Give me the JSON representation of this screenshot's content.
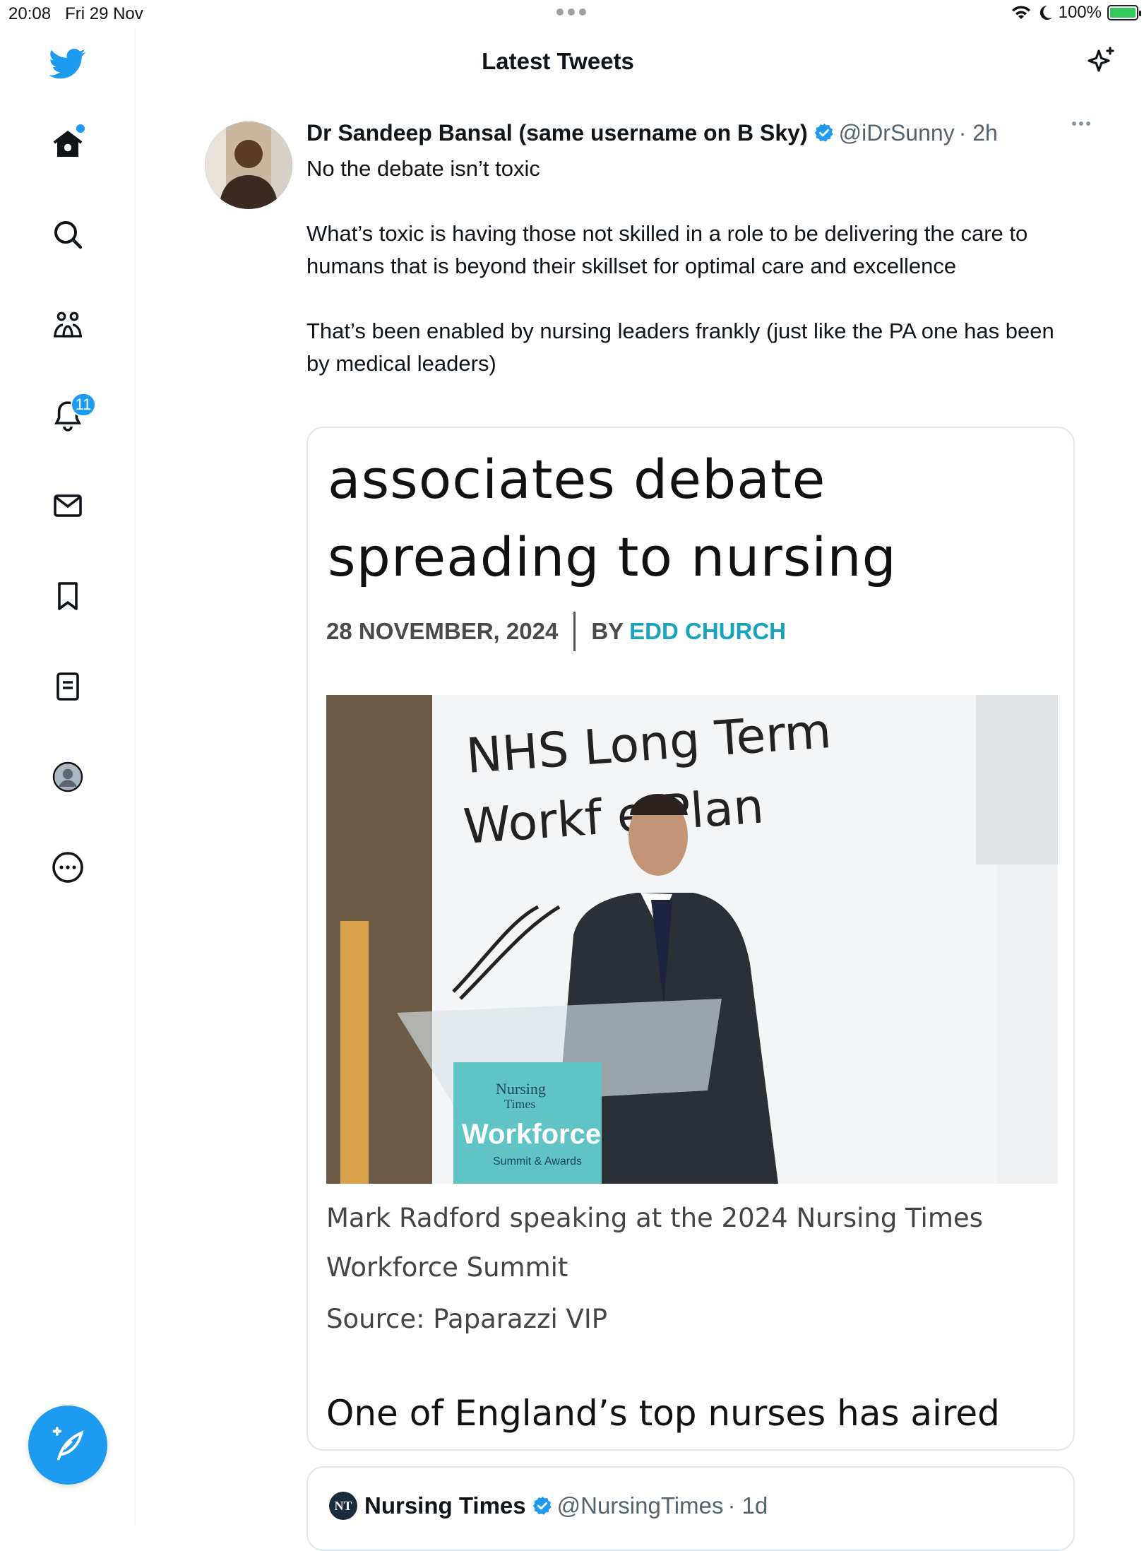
{
  "status_bar": {
    "time": "20:08",
    "date": "Fri 29 Nov",
    "battery": "100%"
  },
  "sidebar": {
    "items": [
      {
        "icon": "home-icon"
      },
      {
        "icon": "search-icon"
      },
      {
        "icon": "communities-icon"
      },
      {
        "icon": "notifications-icon",
        "badge": "11"
      },
      {
        "icon": "messages-icon"
      },
      {
        "icon": "bookmarks-icon"
      },
      {
        "icon": "lists-icon"
      },
      {
        "icon": "profile-icon"
      },
      {
        "icon": "more-icon"
      }
    ],
    "compose_icon": "compose-icon"
  },
  "header": {
    "title": "Latest Tweets"
  },
  "tweet": {
    "author": "Dr Sandeep Bansal (same username on B Sky)",
    "handle": "@iDrSunny",
    "time": "· 2h",
    "paragraphs": [
      "No the debate isn’t toxic",
      "What’s toxic is having those not skilled in a role to be delivering the care to humans that is beyond their skillset for optimal care and excellence",
      "That’s been enabled by nursing leaders frankly (just like the PA one has been by medical leaders)"
    ],
    "card": {
      "headline_line1": "associates debate",
      "headline_line2": "spreading to nursing",
      "date": "28 NOVEMBER, 2024",
      "by": "BY",
      "byline": "EDD CHURCH",
      "photo_sign_line1": "NHS Long Term",
      "photo_sign_line2": "Workf  e Plan",
      "podium_line1": "Nursing",
      "podium_line2": "Times",
      "podium_line3": "Workforce",
      "podium_line4": "Summit & Awards",
      "caption": "Mark Radford speaking at the 2024 Nursing Times Workforce Summit",
      "source": "Source:  Paparazzi VIP",
      "lead": "One of England’s top nurses has aired"
    }
  },
  "quoted_tweet": {
    "logo_text": "NT",
    "author": "Nursing Times",
    "handle": "@NursingTimes",
    "time": "· 1d"
  },
  "colors": {
    "accent": "#1d9bf0",
    "byline": "#1aa3bd",
    "battery": "#34c759"
  }
}
